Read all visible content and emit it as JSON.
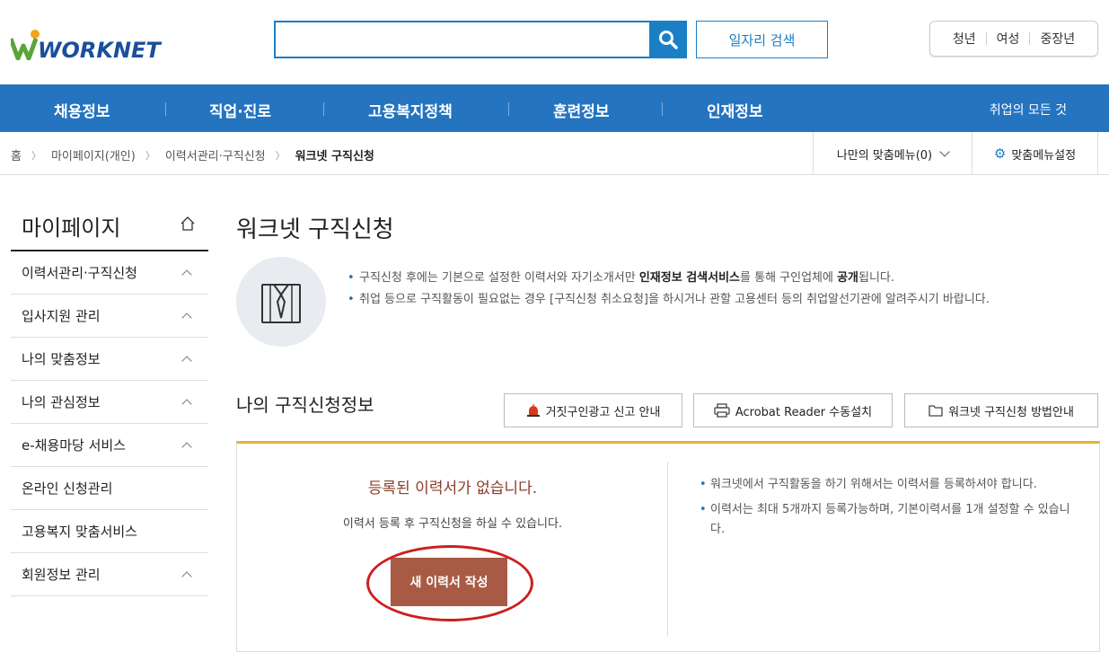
{
  "header": {
    "logo": "WORKNET",
    "search_placeholder": "",
    "job_search_label": "일자리 검색",
    "target_links": [
      "청년",
      "여성",
      "중장년"
    ]
  },
  "nav": {
    "items": [
      "채용정보",
      "직업·진로",
      "고용복지정책",
      "훈련정보",
      "인재정보"
    ],
    "right": "취업의 모든 것"
  },
  "breadcrumb": {
    "items": [
      "홈",
      "마이페이지(개인)",
      "이력서관리·구직신청"
    ],
    "current": "워크넷 구직신청",
    "my_menu": "나만의 맞춤메뉴(0)",
    "menu_settings": "맞춤메뉴설정"
  },
  "sidebar": {
    "title": "마이페이지",
    "items": [
      {
        "label": "이력서관리·구직신청",
        "has_arrow": true
      },
      {
        "label": "입사지원 관리",
        "has_arrow": true
      },
      {
        "label": "나의 맞춤정보",
        "has_arrow": true
      },
      {
        "label": "나의 관심정보",
        "has_arrow": true
      },
      {
        "label": "e-채용마당 서비스",
        "has_arrow": true
      },
      {
        "label": "온라인 신청관리",
        "has_arrow": false
      },
      {
        "label": "고용복지 맞춤서비스",
        "has_arrow": false
      },
      {
        "label": "회원정보 관리",
        "has_arrow": true
      }
    ]
  },
  "main": {
    "title": "워크넷 구직신청",
    "info": {
      "line1_pre": "구직신청 후에는 기본으로 설정한 이력서와 자기소개서만 ",
      "line1_bold1": "인재정보 검색서비스",
      "line1_mid": "를 통해 구인업체에 ",
      "line1_bold2": "공개",
      "line1_post": "됩니다.",
      "line2": "취업 등으로 구직활동이 필요없는 경우 [구직신청 취소요청]을 하시거나 관할 고용센터 등의 취업알선기관에 알려주시기 바랍니다."
    },
    "section_title": "나의 구직신청정보",
    "buttons": {
      "fake_ad": "거짓구인광고 신고 안내",
      "acrobat": "Acrobat Reader 수동설치",
      "guide": "워크넷 구직신청 방법안내"
    },
    "result": {
      "no_resume": "등록된 이력서가 없습니다.",
      "can_apply": "이력서 등록 후 구직신청을 하실 수 있습니다.",
      "new_resume": "새 이력서 작성",
      "notes": [
        "워크넷에서 구직활동을 하기 위해서는 이력서를 등록하셔야 합니다.",
        "이력서는 최대 5개까지 등록가능하며, 기본이력서를 1개 설정할 수 있습니다."
      ]
    }
  }
}
